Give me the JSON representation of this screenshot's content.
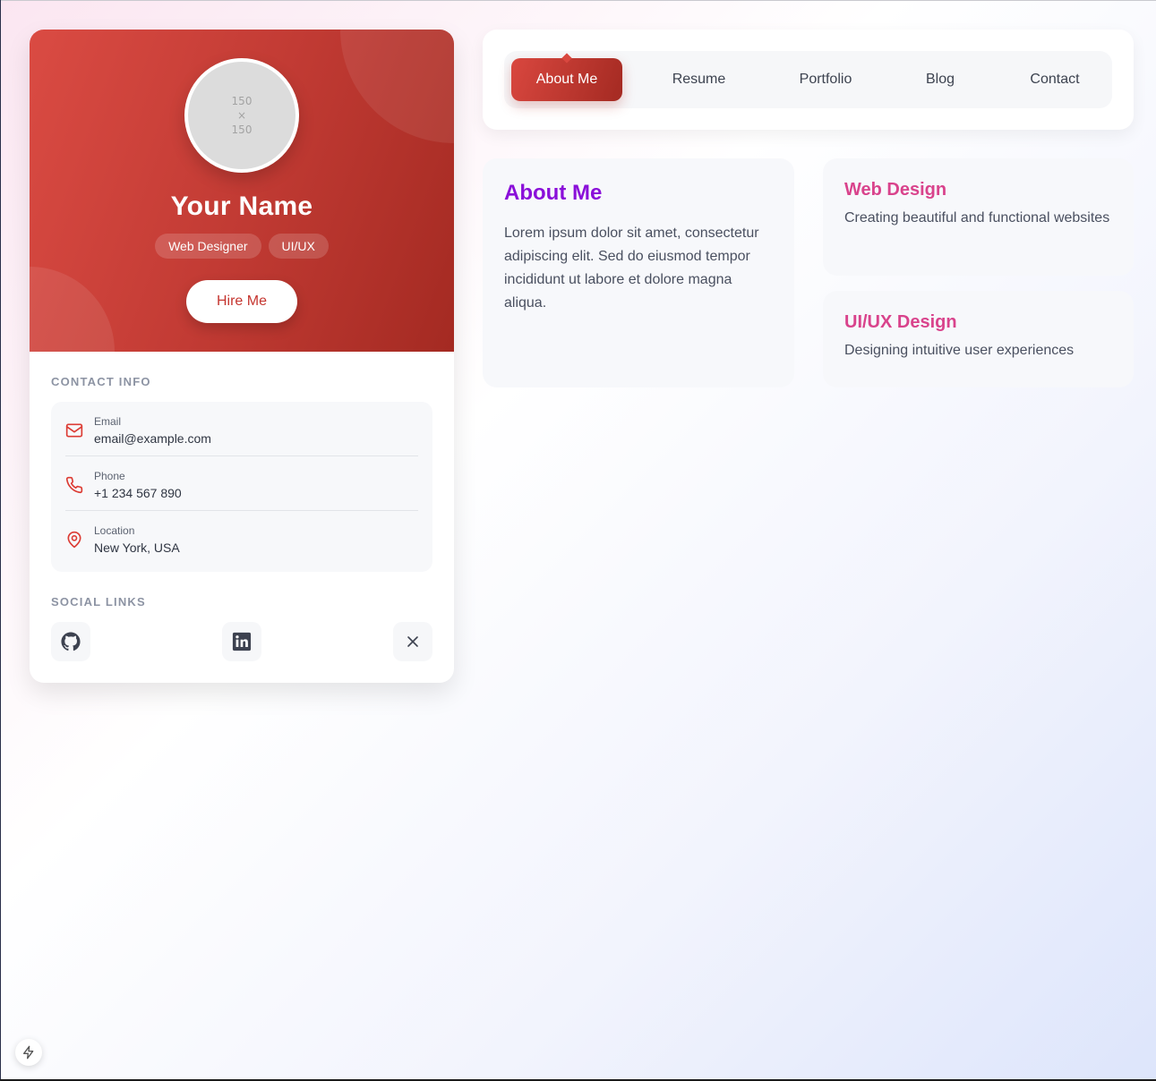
{
  "profile": {
    "avatar_placeholder": {
      "line1": "150",
      "line2": "×",
      "line3": "150"
    },
    "name": "Your Name",
    "tags": [
      "Web Designer",
      "UI/UX"
    ],
    "hire_button": "Hire Me",
    "contact_heading": "CONTACT INFO",
    "contacts": [
      {
        "icon": "mail-icon",
        "label": "Email",
        "value": "email@example.com"
      },
      {
        "icon": "phone-icon",
        "label": "Phone",
        "value": "+1 234 567 890"
      },
      {
        "icon": "map-pin-icon",
        "label": "Location",
        "value": "New York, USA"
      }
    ],
    "social_heading": "SOCIAL LINKS",
    "socials": [
      {
        "icon": "github-icon",
        "name": "GitHub"
      },
      {
        "icon": "linkedin-icon",
        "name": "LinkedIn"
      },
      {
        "icon": "x-twitter-icon",
        "name": "X"
      }
    ]
  },
  "nav": {
    "items": [
      "About Me",
      "Resume",
      "Portfolio",
      "Blog",
      "Contact"
    ],
    "active": "About Me"
  },
  "about": {
    "title": "About Me",
    "text": "Lorem ipsum dolor sit amet, consectetur adipiscing elit. Sed do eiusmod tempor incididunt ut labore et dolore magna aliqua."
  },
  "services": [
    {
      "title": "Web Design",
      "text": "Creating beautiful and functional websites"
    },
    {
      "title": "UI/UX Design",
      "text": "Designing intuitive user experiences"
    }
  ],
  "colors": {
    "accent_red": "#c5352f",
    "about_title": "#8a0fd9",
    "service_title": "#d9438c"
  },
  "floating": {
    "icon": "bolt-icon"
  }
}
